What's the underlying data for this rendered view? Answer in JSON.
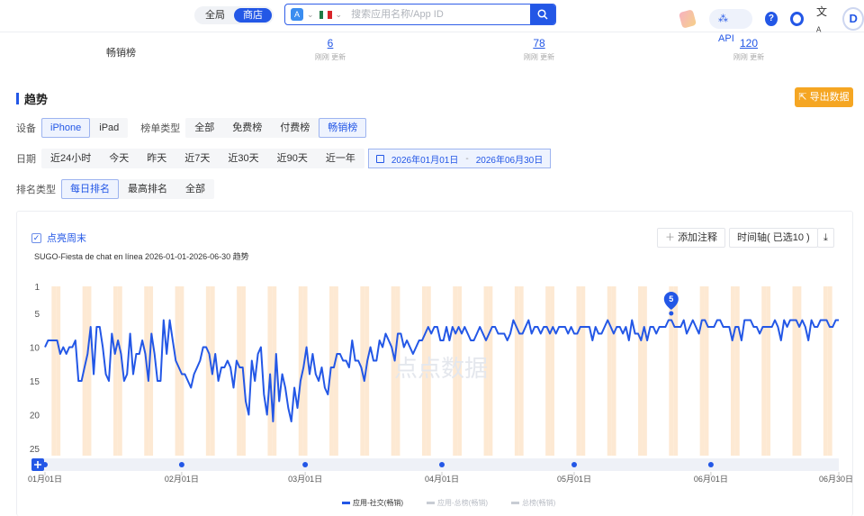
{
  "header": {
    "scope_tabs": [
      {
        "label": "全局",
        "active": false
      },
      {
        "label": "商店",
        "active": true
      }
    ],
    "store_icon": "app-store-icon",
    "country_flag": "mexico-flag",
    "search_placeholder": "搜索应用名称/App ID",
    "api_label": "API",
    "colors": {
      "brand": "#2357e6",
      "export": "#f5a623"
    }
  },
  "top_chart_row": {
    "name": "畅销榜",
    "metrics": [
      {
        "value": "6",
        "sub": "刚刚 更新"
      },
      {
        "value": "78",
        "sub": "刚刚 更新"
      },
      {
        "value": "120",
        "sub": "刚刚 更新"
      }
    ]
  },
  "trend": {
    "title": "趋势",
    "export_label": "导出数据",
    "device": {
      "label": "设备",
      "options": [
        "iPhone",
        "iPad"
      ],
      "selected": "iPhone"
    },
    "list_type": {
      "label": "榜单类型",
      "options": [
        "全部",
        "免费榜",
        "付费榜",
        "畅销榜"
      ],
      "selected": "畅销榜"
    },
    "date": {
      "label": "日期",
      "options": [
        "近24小时",
        "今天",
        "昨天",
        "近7天",
        "近30天",
        "近90天",
        "近一年"
      ],
      "start": "2026年01月01日",
      "separator": "-",
      "end": "2026年06月30日"
    },
    "rank_type": {
      "label": "排名类型",
      "options": [
        "每日排名",
        "最高排名",
        "全部"
      ],
      "selected": "每日排名"
    },
    "weekend_label": "点亮周末",
    "weekend_checked": true,
    "chart_title": "SUGO-Fiesta de chat en línea 2026-01-01-2026-06-30 趋势",
    "add_note_label": "添加注释",
    "timeline_label": "时间轴( 已选10 )",
    "watermark": "点点数据"
  },
  "chart_data": {
    "type": "line",
    "yaxis_inverted": true,
    "ylim": [
      1,
      25
    ],
    "yticks": [
      1,
      5,
      10,
      15,
      20,
      25
    ],
    "x_start": "2026-01-01",
    "xtick_labels": [
      "01月01日",
      "02月01日",
      "03月01日",
      "04月01日",
      "05月01日",
      "06月01日",
      "06月30日"
    ],
    "xtick_days": [
      0,
      31,
      59,
      90,
      120,
      151,
      180
    ],
    "weekends_highlighted": true,
    "weekend_color": "#fde9d3",
    "line_color": "#2357e6",
    "marker": {
      "label": "5",
      "day": 142
    },
    "legend": [
      {
        "name": "应用-社交(畅销)",
        "active": true,
        "color": "#2357e6"
      },
      {
        "name": "应用-总榜(畅销)",
        "active": false,
        "color": "#c8ccd4"
      },
      {
        "name": "总榜(畅销)",
        "active": false,
        "color": "#c8ccd4"
      }
    ],
    "series": [
      {
        "name": "应用-社交(畅销)",
        "values": [
          10,
          9,
          9,
          9,
          9,
          11,
          10,
          11,
          10,
          10,
          9,
          15,
          15,
          13,
          11,
          7,
          14,
          7,
          7,
          10,
          14,
          15,
          8,
          11,
          9,
          11,
          15,
          14,
          8,
          14,
          11,
          11,
          9,
          11,
          15,
          8,
          11,
          15,
          15,
          6,
          11,
          6,
          9,
          12,
          13,
          14,
          14,
          15,
          16,
          14,
          13,
          12,
          10,
          10,
          11,
          14,
          11,
          15,
          13,
          13,
          12,
          13,
          16,
          12,
          13,
          13,
          18,
          20,
          12,
          15,
          11,
          10,
          17,
          20,
          14,
          21,
          11,
          18,
          14,
          16,
          19,
          21,
          16,
          19,
          15,
          13,
          10,
          14,
          11,
          14,
          15,
          13,
          16,
          17,
          13,
          13,
          11,
          11,
          12,
          12,
          13,
          9,
          12,
          12,
          13,
          15,
          12,
          10,
          12,
          12,
          9,
          10,
          8,
          9,
          10,
          12,
          8,
          8,
          10,
          9,
          10,
          11,
          10,
          9,
          9,
          8,
          7,
          8,
          7,
          7,
          9,
          9,
          7,
          9,
          7,
          8,
          7,
          8,
          7,
          8,
          9,
          9,
          8,
          7,
          8,
          9,
          8,
          7,
          7,
          8,
          8,
          8,
          9,
          8,
          6,
          7,
          8,
          8,
          7,
          6,
          8,
          7,
          7,
          8,
          7,
          7,
          8,
          7,
          8,
          7,
          7,
          7,
          8,
          7,
          8,
          8,
          7,
          7,
          7,
          7,
          9,
          7,
          8,
          8,
          7,
          6,
          7,
          8,
          7,
          7,
          8,
          7,
          9,
          6,
          8,
          8,
          9,
          7,
          9,
          7,
          7,
          8,
          7,
          7,
          7,
          6,
          6,
          7,
          7,
          7,
          6,
          8,
          7,
          6,
          7,
          8,
          6,
          6,
          7,
          7,
          7,
          6,
          6,
          7,
          7,
          7,
          9,
          7,
          7,
          9,
          6,
          6,
          6,
          7,
          7,
          8,
          7,
          7,
          7,
          7,
          6,
          7,
          9,
          6,
          7,
          6,
          6,
          6,
          7,
          6,
          7,
          9,
          6,
          7,
          7,
          6,
          6,
          6,
          7,
          7,
          6,
          6
        ]
      }
    ]
  }
}
